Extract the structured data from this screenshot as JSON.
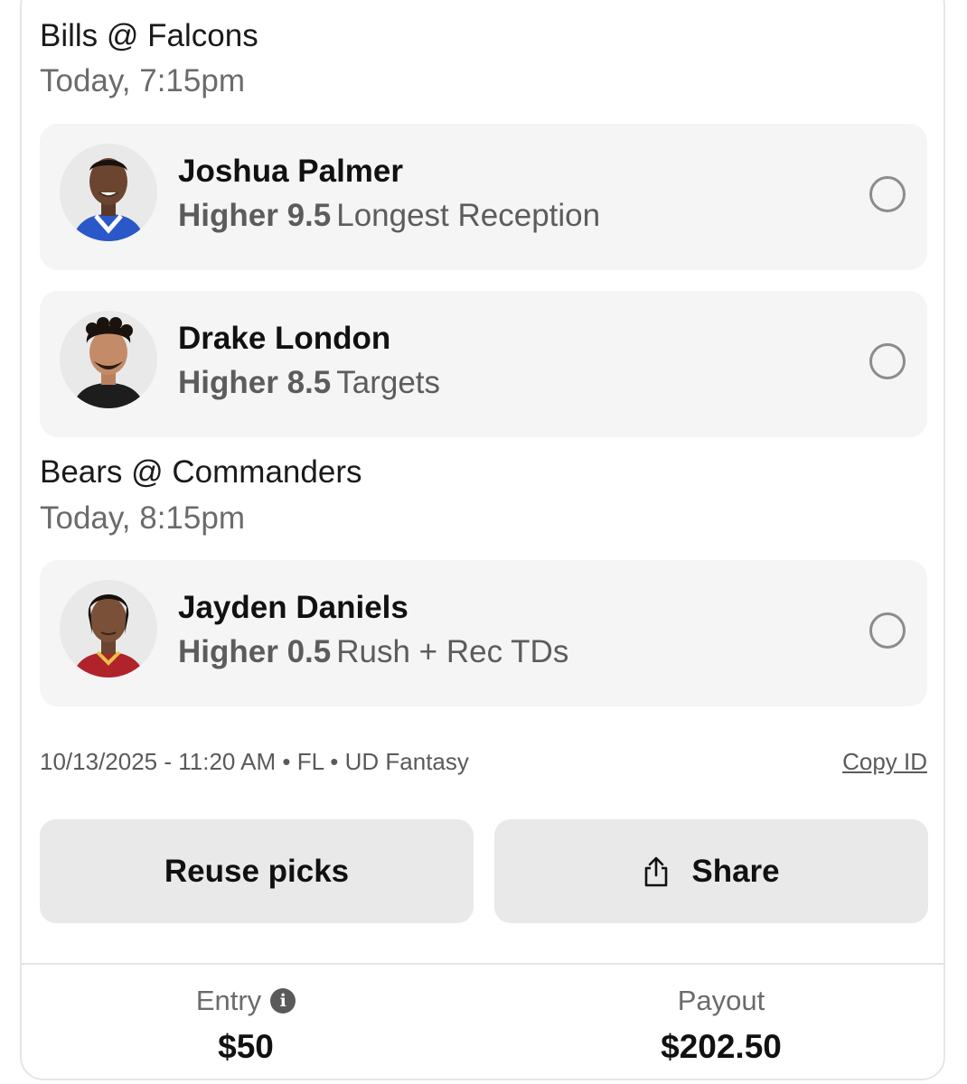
{
  "games": [
    {
      "title": "Bills @ Falcons",
      "time": "Today, 7:15pm",
      "picks": [
        {
          "player": "Joshua Palmer",
          "direction": "Higher 9.5",
          "stat": "Longest Reception",
          "jersey_color": "#2a58c8"
        },
        {
          "player": "Drake London",
          "direction": "Higher 8.5",
          "stat": "Targets",
          "jersey_color": "#1d1d1d"
        }
      ]
    },
    {
      "title": "Bears @ Commanders",
      "time": "Today, 8:15pm",
      "picks": [
        {
          "player": "Jayden Daniels",
          "direction": "Higher 0.5",
          "stat": "Rush + Rec TDs",
          "jersey_color": "#b0232a"
        }
      ]
    }
  ],
  "meta": {
    "text": "10/13/2025 - 11:20 AM • FL • UD Fantasy",
    "copy_id": "Copy ID"
  },
  "buttons": {
    "reuse": "Reuse picks",
    "share": "Share",
    "share_icon": "share-icon"
  },
  "footer": {
    "entry_label": "Entry",
    "entry_value": "$50",
    "payout_label": "Payout",
    "payout_value": "$202.50",
    "info_icon": "info-icon"
  }
}
